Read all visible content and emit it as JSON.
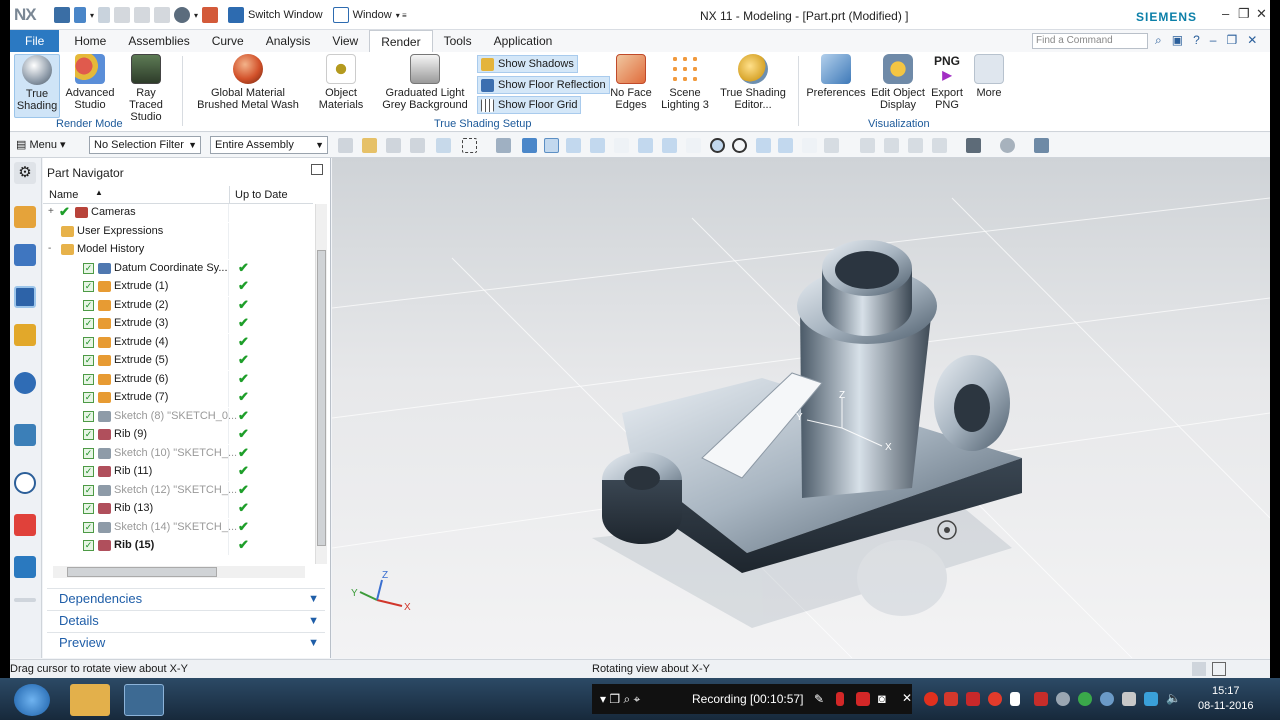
{
  "app": {
    "logo": "NX",
    "title": "NX 11 - Modeling - [Part.prt (Modified) ]",
    "brand": "SIEMENS",
    "quick_access": {
      "switch_window": "Switch Window",
      "window_menu": "Window"
    }
  },
  "tabs": [
    "File",
    "Home",
    "Assemblies",
    "Curve",
    "Analysis",
    "View",
    "Render",
    "Tools",
    "Application"
  ],
  "active_tab": "Render",
  "find_command_placeholder": "Find a Command",
  "ribbon": {
    "true_shading": "True\nShading",
    "advanced_studio": "Advanced\nStudio",
    "ray_traced_studio": "Ray Traced\nStudio",
    "render_mode_group": "Render Mode",
    "global_material": "Global Material\nBrushed Metal Wash",
    "object_materials": "Object\nMaterials",
    "graduated_light": "Graduated Light\nGrey Background",
    "show_shadows": "Show Shadows",
    "show_floor_reflection": "Show Floor Reflection",
    "show_floor_grid": "Show Floor Grid",
    "no_face_edges": "No Face\nEdges",
    "scene_lighting": "Scene\nLighting 3",
    "true_shading_editor": "True Shading\nEditor...",
    "true_shading_setup_group": "True Shading Setup",
    "preferences": "Preferences",
    "edit_object_display": "Edit Object\nDisplay",
    "export_png": "Export\nPNG",
    "png_label": "PNG",
    "more": "More",
    "visualization_group": "Visualization"
  },
  "toolbar": {
    "menu": "Menu",
    "selection_filter": "No Selection Filter",
    "scope": "Entire Assembly"
  },
  "navigator": {
    "title": "Part Navigator",
    "col_name": "Name",
    "col_uptodate": "Up to Date",
    "rows": [
      {
        "label": "Cameras",
        "indent": 0,
        "check": false,
        "muted": false,
        "bold": false,
        "expander": "+"
      },
      {
        "label": "User Expressions",
        "indent": 0,
        "check": false,
        "muted": false,
        "bold": false,
        "expander": ""
      },
      {
        "label": "Model History",
        "indent": 0,
        "check": false,
        "muted": false,
        "bold": false,
        "expander": "-"
      },
      {
        "label": "Datum Coordinate Sy...",
        "indent": 1,
        "check": true,
        "muted": false,
        "bold": false
      },
      {
        "label": "Extrude (1)",
        "indent": 1,
        "check": true,
        "muted": false,
        "bold": false
      },
      {
        "label": "Extrude (2)",
        "indent": 1,
        "check": true,
        "muted": false,
        "bold": false
      },
      {
        "label": "Extrude (3)",
        "indent": 1,
        "check": true,
        "muted": false,
        "bold": false
      },
      {
        "label": "Extrude (4)",
        "indent": 1,
        "check": true,
        "muted": false,
        "bold": false
      },
      {
        "label": "Extrude (5)",
        "indent": 1,
        "check": true,
        "muted": false,
        "bold": false
      },
      {
        "label": "Extrude (6)",
        "indent": 1,
        "check": true,
        "muted": false,
        "bold": false
      },
      {
        "label": "Extrude (7)",
        "indent": 1,
        "check": true,
        "muted": false,
        "bold": false
      },
      {
        "label": "Sketch (8) \"SKETCH_0...",
        "indent": 1,
        "check": true,
        "muted": true,
        "bold": false
      },
      {
        "label": "Rib (9)",
        "indent": 1,
        "check": true,
        "muted": false,
        "bold": false
      },
      {
        "label": "Sketch (10) \"SKETCH_...",
        "indent": 1,
        "check": true,
        "muted": true,
        "bold": false
      },
      {
        "label": "Rib (11)",
        "indent": 1,
        "check": true,
        "muted": false,
        "bold": false
      },
      {
        "label": "Sketch (12) \"SKETCH_...",
        "indent": 1,
        "check": true,
        "muted": true,
        "bold": false
      },
      {
        "label": "Rib (13)",
        "indent": 1,
        "check": true,
        "muted": false,
        "bold": false
      },
      {
        "label": "Sketch (14) \"SKETCH_...",
        "indent": 1,
        "check": true,
        "muted": true,
        "bold": false
      },
      {
        "label": "Rib (15)",
        "indent": 1,
        "check": true,
        "muted": false,
        "bold": true
      }
    ],
    "panels": [
      "Dependencies",
      "Details",
      "Preview"
    ]
  },
  "status": {
    "left": "Drag cursor to rotate view about X-Y",
    "center": "Rotating view about X-Y"
  },
  "taskbar": {
    "recording": "Recording [00:10:57]",
    "time": "15:17",
    "date": "08-11-2016"
  },
  "triad": {
    "x": "X",
    "y": "Y",
    "z": "Z"
  },
  "colors": {
    "accent": "#2b79c2",
    "check": "#1e9e2a",
    "part": "#5f7488"
  }
}
